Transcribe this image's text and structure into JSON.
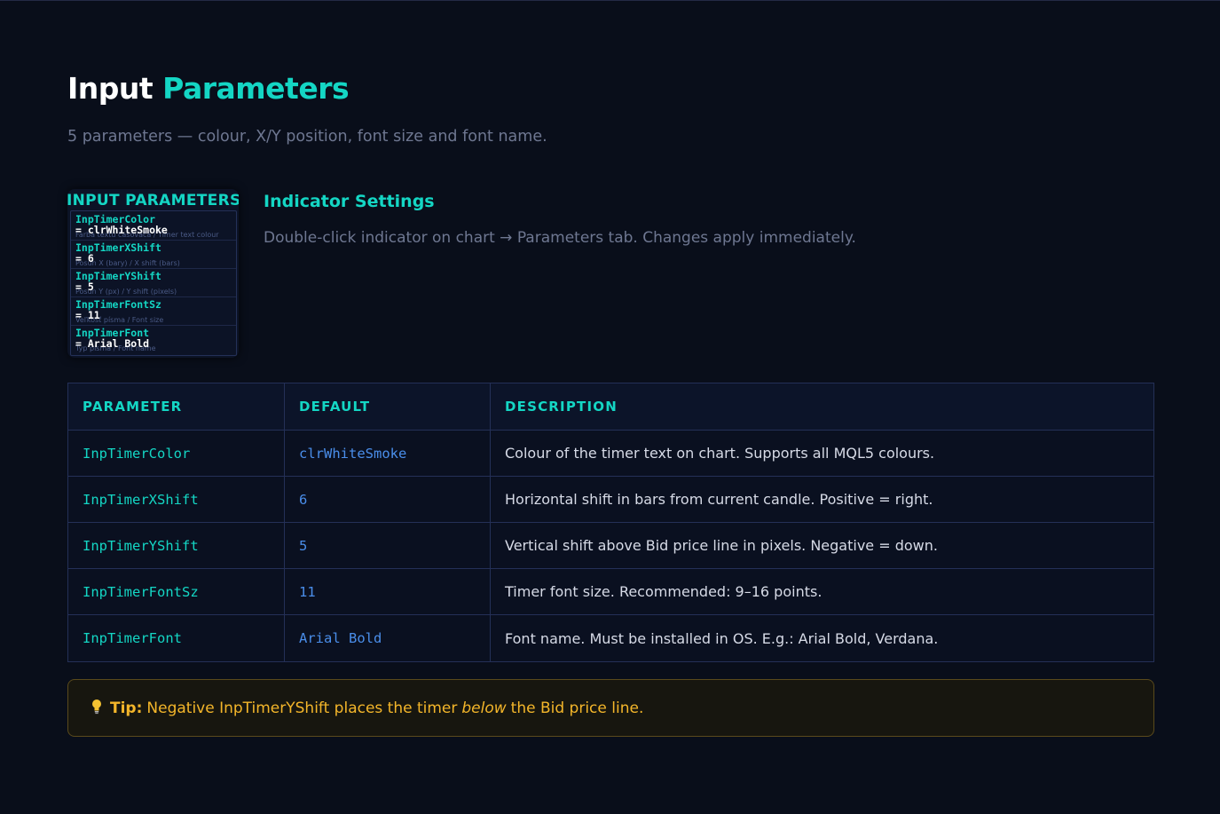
{
  "title": {
    "part1": "Input",
    "part2": "Parameters"
  },
  "subtitle": "5 parameters — colour, X/Y position, font size and font name.",
  "mini_panel": {
    "header": "INPUT PARAMETERS",
    "rows": [
      {
        "name": "InpTimerColor",
        "value": "= clrWhiteSmoke",
        "desc": "Farba textu časovača / Timer text colour"
      },
      {
        "name": "InpTimerXShift",
        "value": "= 6",
        "desc": "Posun X (bary) / X shift (bars)"
      },
      {
        "name": "InpTimerYShift",
        "value": "= 5",
        "desc": "Posun Y (px) / Y shift (pixels)"
      },
      {
        "name": "InpTimerFontSz",
        "value": "= 11",
        "desc": "Veľkosť písma / Font size"
      },
      {
        "name": "InpTimerFont",
        "value": "= Arial Bold",
        "desc": "Typ písma / Font name"
      }
    ]
  },
  "settings": {
    "title": "Indicator Settings",
    "description": "Double-click indicator on chart → Parameters tab. Changes apply immediately."
  },
  "table": {
    "headers": [
      "PARAMETER",
      "DEFAULT",
      "DESCRIPTION"
    ],
    "rows": [
      {
        "param": "InpTimerColor",
        "default": "clrWhiteSmoke",
        "description": "Colour of the timer text on chart. Supports all MQL5 colours."
      },
      {
        "param": "InpTimerXShift",
        "default": "6",
        "description": "Horizontal shift in bars from current candle. Positive = right."
      },
      {
        "param": "InpTimerYShift",
        "default": "5",
        "description": "Vertical shift above Bid price line in pixels. Negative = down."
      },
      {
        "param": "InpTimerFontSz",
        "default": "11",
        "description": "Timer font size. Recommended: 9–16 points."
      },
      {
        "param": "InpTimerFont",
        "default": "Arial Bold",
        "description": "Font name. Must be installed in OS. E.g.: Arial Bold, Verdana."
      }
    ]
  },
  "tip": {
    "icon": "lightbulb-icon",
    "label": "Tip:",
    "text_before": "Negative InpTimerYShift places the timer",
    "emphasis": "below",
    "text_after": "the Bid price line."
  },
  "colors": {
    "background": "#090e1a",
    "accent": "#14d6c4",
    "default_value": "#4a8eea",
    "tip_text": "#f4b62a"
  }
}
